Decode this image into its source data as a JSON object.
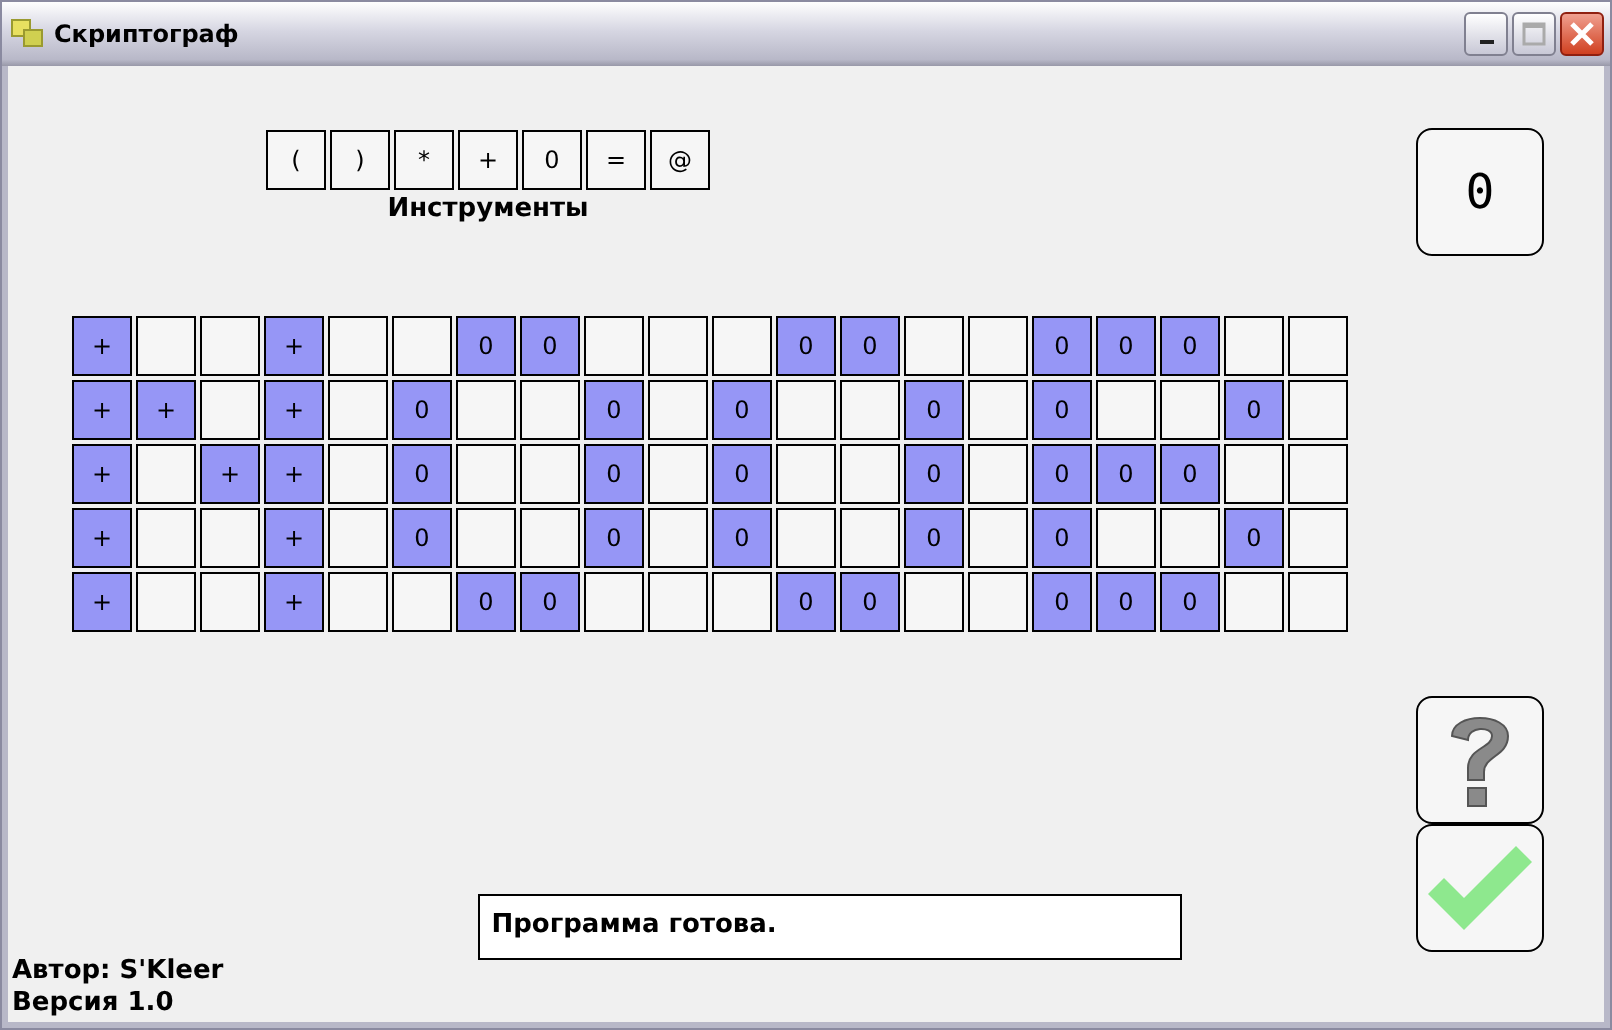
{
  "window": {
    "title": "Скриптограф"
  },
  "tools": {
    "items": [
      "(",
      ")",
      "*",
      "+",
      "0",
      "=",
      "@"
    ],
    "label": "Инструменты"
  },
  "counter": "0",
  "grid": [
    [
      {
        "filled": true,
        "text": "+"
      },
      {
        "filled": false
      },
      {
        "filled": false
      },
      {
        "filled": true,
        "text": "+"
      },
      {
        "filled": false
      },
      {
        "filled": false
      },
      {
        "filled": true,
        "text": "0"
      },
      {
        "filled": true,
        "text": "0"
      },
      {
        "filled": false
      },
      {
        "filled": false
      },
      {
        "filled": false
      },
      {
        "filled": true,
        "text": "0"
      },
      {
        "filled": true,
        "text": "0"
      },
      {
        "filled": false
      },
      {
        "filled": false
      },
      {
        "filled": true,
        "text": "0"
      },
      {
        "filled": true,
        "text": "0"
      },
      {
        "filled": true,
        "text": "0"
      },
      {
        "filled": false
      },
      {
        "filled": false
      }
    ],
    [
      {
        "filled": true,
        "text": "+"
      },
      {
        "filled": true,
        "text": "+"
      },
      {
        "filled": false
      },
      {
        "filled": true,
        "text": "+"
      },
      {
        "filled": false
      },
      {
        "filled": true,
        "text": "0"
      },
      {
        "filled": false
      },
      {
        "filled": false
      },
      {
        "filled": true,
        "text": "0"
      },
      {
        "filled": false
      },
      {
        "filled": true,
        "text": "0"
      },
      {
        "filled": false
      },
      {
        "filled": false
      },
      {
        "filled": true,
        "text": "0"
      },
      {
        "filled": false
      },
      {
        "filled": true,
        "text": "0"
      },
      {
        "filled": false
      },
      {
        "filled": false
      },
      {
        "filled": true,
        "text": "0"
      },
      {
        "filled": false
      }
    ],
    [
      {
        "filled": true,
        "text": "+"
      },
      {
        "filled": false
      },
      {
        "filled": true,
        "text": "+"
      },
      {
        "filled": true,
        "text": "+"
      },
      {
        "filled": false
      },
      {
        "filled": true,
        "text": "0"
      },
      {
        "filled": false
      },
      {
        "filled": false
      },
      {
        "filled": true,
        "text": "0"
      },
      {
        "filled": false
      },
      {
        "filled": true,
        "text": "0"
      },
      {
        "filled": false
      },
      {
        "filled": false
      },
      {
        "filled": true,
        "text": "0"
      },
      {
        "filled": false
      },
      {
        "filled": true,
        "text": "0"
      },
      {
        "filled": true,
        "text": "0"
      },
      {
        "filled": true,
        "text": "0"
      },
      {
        "filled": false
      },
      {
        "filled": false
      }
    ],
    [
      {
        "filled": true,
        "text": "+"
      },
      {
        "filled": false
      },
      {
        "filled": false
      },
      {
        "filled": true,
        "text": "+"
      },
      {
        "filled": false
      },
      {
        "filled": true,
        "text": "0"
      },
      {
        "filled": false
      },
      {
        "filled": false
      },
      {
        "filled": true,
        "text": "0"
      },
      {
        "filled": false
      },
      {
        "filled": true,
        "text": "0"
      },
      {
        "filled": false
      },
      {
        "filled": false
      },
      {
        "filled": true,
        "text": "0"
      },
      {
        "filled": false
      },
      {
        "filled": true,
        "text": "0"
      },
      {
        "filled": false
      },
      {
        "filled": false
      },
      {
        "filled": true,
        "text": "0"
      },
      {
        "filled": false
      }
    ],
    [
      {
        "filled": true,
        "text": "+"
      },
      {
        "filled": false
      },
      {
        "filled": false
      },
      {
        "filled": true,
        "text": "+"
      },
      {
        "filled": false
      },
      {
        "filled": false
      },
      {
        "filled": true,
        "text": "0"
      },
      {
        "filled": true,
        "text": "0"
      },
      {
        "filled": false
      },
      {
        "filled": false
      },
      {
        "filled": false
      },
      {
        "filled": true,
        "text": "0"
      },
      {
        "filled": true,
        "text": "0"
      },
      {
        "filled": false
      },
      {
        "filled": false
      },
      {
        "filled": true,
        "text": "0"
      },
      {
        "filled": true,
        "text": "0"
      },
      {
        "filled": true,
        "text": "0"
      },
      {
        "filled": false
      },
      {
        "filled": false
      }
    ]
  ],
  "status": "Программа готова.",
  "author": "Автор: S'Kleer",
  "version": "Версия 1.0"
}
